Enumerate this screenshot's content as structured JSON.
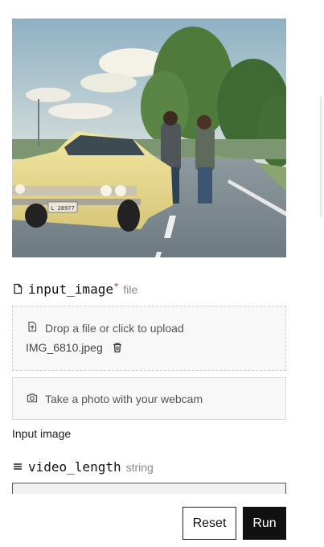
{
  "preview": {
    "image_alt": "Vintage yellow car with two people standing on a road",
    "plate_text": "L 28977"
  },
  "input_image": {
    "name": "input_image",
    "required_mark": "*",
    "type": "file",
    "icon": "file-icon",
    "dropzone_text": "Drop a file or click to upload",
    "dropzone_icon": "file-upload-icon",
    "file_name": "IMG_6810.jpeg",
    "delete_icon": "trash-icon",
    "webcam_text": "Take a photo with your webcam",
    "webcam_icon": "camera-icon",
    "caption": "Input image"
  },
  "video_length": {
    "name": "video_length",
    "type": "string",
    "icon": "text-lines-icon",
    "value": ""
  },
  "actions": {
    "reset_label": "Reset",
    "run_label": "Run"
  },
  "colors": {
    "required": "#e0433f",
    "run_bg": "#111111",
    "muted": "#8a8a8a"
  }
}
